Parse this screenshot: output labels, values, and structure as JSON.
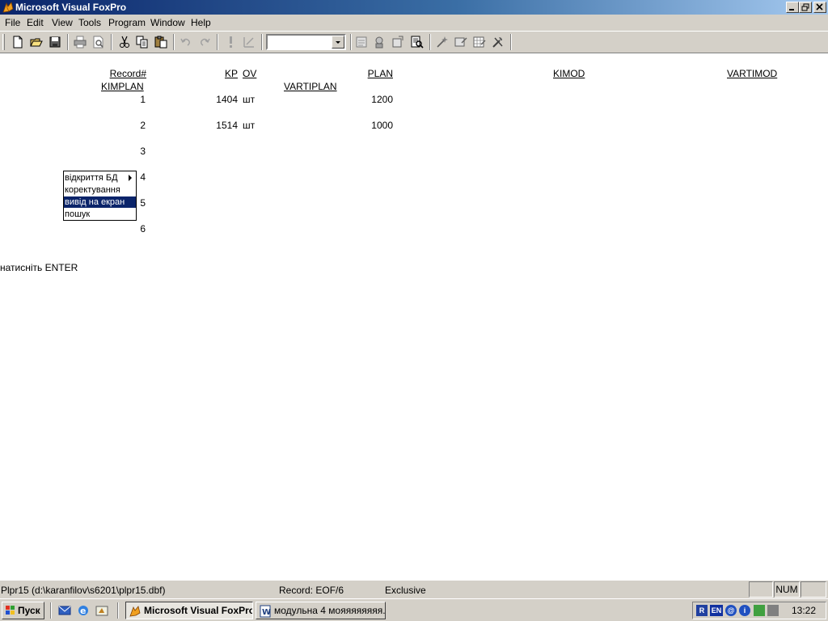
{
  "window": {
    "title": "Microsoft Visual FoxPro"
  },
  "menubar": {
    "items": [
      "File",
      "Edit",
      "View",
      "Tools",
      "Program",
      "Window",
      "Help"
    ]
  },
  "table": {
    "headers": {
      "record": "Record#",
      "kp": "KP",
      "ov": "OV",
      "plan": "PLAN",
      "kimod": "KIMOD",
      "vartimod": "VARTIMOD",
      "kimplan": "KIMPLAN",
      "vartiplan": "VARTIPLAN"
    },
    "rows": [
      {
        "record": "1",
        "kp": "1404",
        "ov": "шт",
        "plan": "1200"
      },
      {
        "record": "2",
        "kp": "1514",
        "ov": "шт",
        "plan": "1000"
      },
      {
        "record": "3",
        "kp": "",
        "ov": "",
        "plan": ""
      },
      {
        "record": "4",
        "kp": "",
        "ov": "",
        "plan": ""
      },
      {
        "record": "5",
        "kp": "",
        "ov": "",
        "plan": ""
      },
      {
        "record": "6",
        "kp": "",
        "ov": "",
        "plan": ""
      }
    ]
  },
  "popup_menu": {
    "items": [
      {
        "label": "відкриття БД",
        "has_submenu": true,
        "selected": false
      },
      {
        "label": "коректування",
        "has_submenu": false,
        "selected": false
      },
      {
        "label": "вивід на екран",
        "has_submenu": false,
        "selected": true
      },
      {
        "label": "пошук",
        "has_submenu": false,
        "selected": false
      }
    ]
  },
  "prompt": {
    "text": "натисніть ENTER"
  },
  "statusbar": {
    "file": "Plpr15 (d:\\karanfilov\\s6201\\plpr15.dbf)",
    "record": "Record: EOF/6",
    "mode": "Exclusive",
    "num": "NUM"
  },
  "taskbar": {
    "start_label": "Пуск",
    "tasks": [
      {
        "label": "Microsoft Visual FoxPro",
        "active": true
      },
      {
        "label": "модульна 4 мояяяяяяяя...",
        "active": false
      }
    ],
    "tray": {
      "lang": "EN",
      "clock": "13:22"
    }
  },
  "colors": {
    "title_active": "#0a246a",
    "chrome": "#d4d0c8",
    "selection": "#0a246a"
  }
}
